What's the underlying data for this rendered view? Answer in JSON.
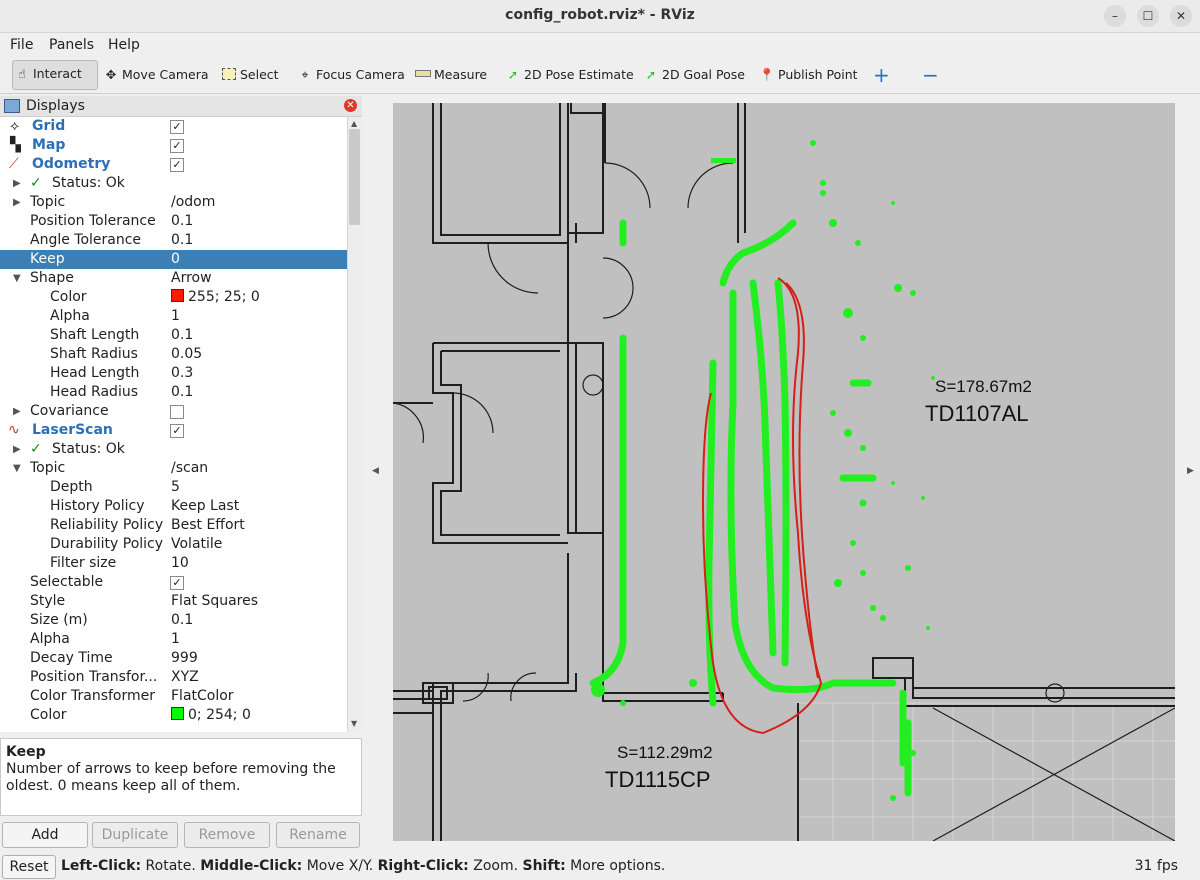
{
  "window": {
    "title": "config_robot.rviz* - RViz"
  },
  "menu": [
    "File",
    "Panels",
    "Help"
  ],
  "toolbar": {
    "interact": "Interact",
    "move_camera": "Move Camera",
    "select": "Select",
    "focus_camera": "Focus Camera",
    "measure": "Measure",
    "pose_estimate": "2D Pose Estimate",
    "goal_pose": "2D Goal Pose",
    "publish_point": "Publish Point"
  },
  "displays": {
    "title": "Displays",
    "rows": [
      {
        "label": "Grid",
        "value": "",
        "check": true
      },
      {
        "label": "Map",
        "value": "",
        "check": true
      },
      {
        "label": "Odometry",
        "value": "",
        "check": true
      },
      {
        "label": "Status: Ok",
        "value": ""
      },
      {
        "label": "Topic",
        "value": "/odom"
      },
      {
        "label": "Position Tolerance",
        "value": "0.1"
      },
      {
        "label": "Angle Tolerance",
        "value": "0.1"
      },
      {
        "label": "Keep",
        "value": "0"
      },
      {
        "label": "Shape",
        "value": "Arrow"
      },
      {
        "label": "Color",
        "value": "255; 25; 0"
      },
      {
        "label": "Alpha",
        "value": "1"
      },
      {
        "label": "Shaft Length",
        "value": "0.1"
      },
      {
        "label": "Shaft Radius",
        "value": "0.05"
      },
      {
        "label": "Head Length",
        "value": "0.3"
      },
      {
        "label": "Head Radius",
        "value": "0.1"
      },
      {
        "label": "Covariance",
        "value": "",
        "check": false
      },
      {
        "label": "LaserScan",
        "value": "",
        "check": true
      },
      {
        "label": "Status: Ok",
        "value": ""
      },
      {
        "label": "Topic",
        "value": "/scan"
      },
      {
        "label": "Depth",
        "value": "5"
      },
      {
        "label": "History Policy",
        "value": "Keep Last"
      },
      {
        "label": "Reliability Policy",
        "value": "Best Effort"
      },
      {
        "label": "Durability Policy",
        "value": "Volatile"
      },
      {
        "label": "Filter size",
        "value": "10"
      },
      {
        "label": "Selectable",
        "value": "",
        "check": true
      },
      {
        "label": "Style",
        "value": "Flat Squares"
      },
      {
        "label": "Size (m)",
        "value": "0.1"
      },
      {
        "label": "Alpha",
        "value": "1"
      },
      {
        "label": "Decay Time",
        "value": "999"
      },
      {
        "label": "Position Transfor...",
        "value": "XYZ"
      },
      {
        "label": "Color Transformer",
        "value": "FlatColor"
      },
      {
        "label": "Color",
        "value": "0; 254; 0"
      }
    ],
    "colors": {
      "odometry_color": "#ff1900",
      "laser_color": "#00fe00",
      "selection": "#3c7fb5"
    }
  },
  "description": {
    "title": "Keep",
    "body": "Number of arrows to keep before removing the oldest. 0 means keep all of them."
  },
  "buttons": {
    "add": "Add",
    "duplicate": "Duplicate",
    "remove": "Remove",
    "rename": "Rename"
  },
  "map": {
    "room1_area": "S=178.67m2",
    "room1_name": "TD1107AL",
    "room2_area": "S=112.29m2",
    "room2_name": "TD1115CP"
  },
  "status": {
    "reset": "Reset",
    "hint_parts": [
      "Left-Click:",
      " Rotate. ",
      "Middle-Click:",
      " Move X/Y. ",
      "Right-Click:",
      " Zoom. ",
      "Shift:",
      " More options."
    ],
    "fps": "31 fps"
  }
}
